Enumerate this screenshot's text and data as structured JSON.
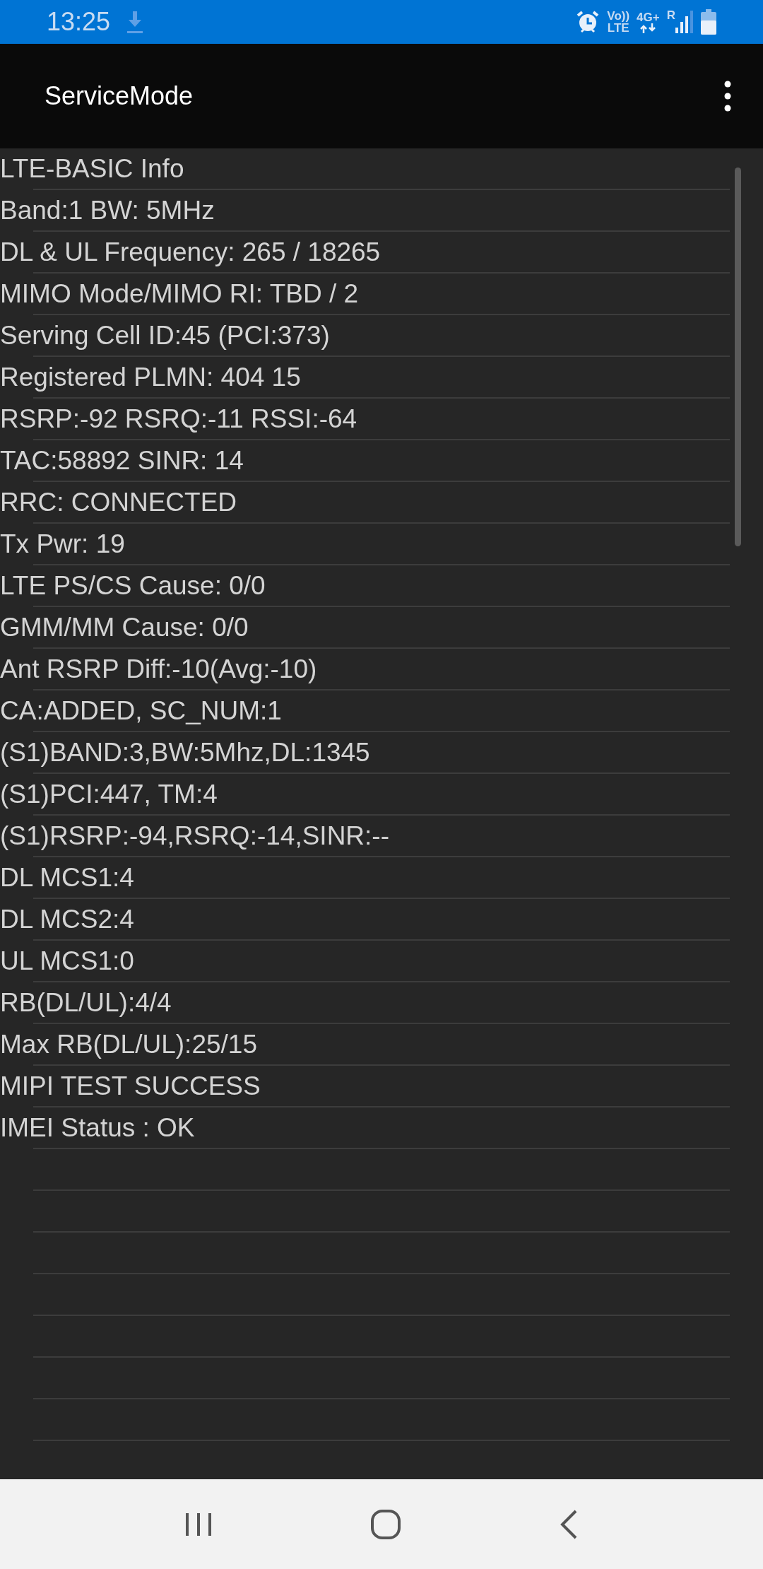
{
  "status_bar": {
    "time": "13:25",
    "volte_top": "Vo))",
    "volte_bottom": "LTE",
    "network": "4G+",
    "roaming": "R"
  },
  "app_bar": {
    "title": "ServiceMode"
  },
  "lines": [
    "LTE-BASIC Info",
    "Band:1 BW: 5MHz",
    "DL & UL Frequency: 265 / 18265",
    "MIMO Mode/MIMO RI: TBD / 2",
    "Serving Cell ID:45 (PCI:373)",
    "Registered PLMN: 404 15",
    "RSRP:-92 RSRQ:-11 RSSI:-64",
    "TAC:58892 SINR: 14",
    "RRC: CONNECTED",
    "Tx Pwr: 19",
    "LTE PS/CS Cause: 0/0",
    "GMM/MM Cause: 0/0",
    "Ant RSRP Diff:-10(Avg:-10)",
    "CA:ADDED, SC_NUM:1",
    "(S1)BAND:3,BW:5Mhz,DL:1345",
    "(S1)PCI:447, TM:4",
    "(S1)RSRP:-94,RSRQ:-14,SINR:--",
    "DL MCS1:4",
    "DL MCS2:4",
    "UL MCS1:0",
    "RB(DL/UL):4/4",
    "Max RB(DL/UL):25/15",
    "MIPI TEST SUCCESS",
    "IMEI Status : OK"
  ]
}
